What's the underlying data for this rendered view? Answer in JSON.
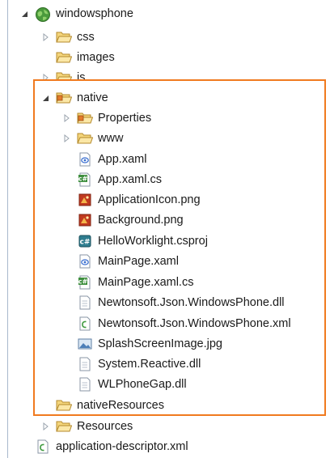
{
  "tree": {
    "root": "windowsphone",
    "css": "css",
    "images": "images",
    "js": "js",
    "native": "native",
    "native_children": {
      "properties": "Properties",
      "www": "www",
      "app_xaml": "App.xaml",
      "app_xaml_cs": "App.xaml.cs",
      "application_icon": "ApplicationIcon.png",
      "background": "Background.png",
      "csproj": "HelloWorklight.csproj",
      "mainpage_xaml": "MainPage.xaml",
      "mainpage_xaml_cs": "MainPage.xaml.cs",
      "newtonsoft_dll": "Newtonsoft.Json.WindowsPhone.dll",
      "newtonsoft_xml": "Newtonsoft.Json.WindowsPhone.xml",
      "splash": "SplashScreenImage.jpg",
      "reactive": "System.Reactive.dll",
      "wlphonegap": "WLPhoneGap.dll"
    },
    "native_resources": "nativeResources",
    "resources": "Resources",
    "app_descriptor": "application-descriptor.xml"
  },
  "colors": {
    "highlight_border": "#f07a1f",
    "folder": "#e9c46a",
    "selection_line": "#a9b8cc"
  }
}
